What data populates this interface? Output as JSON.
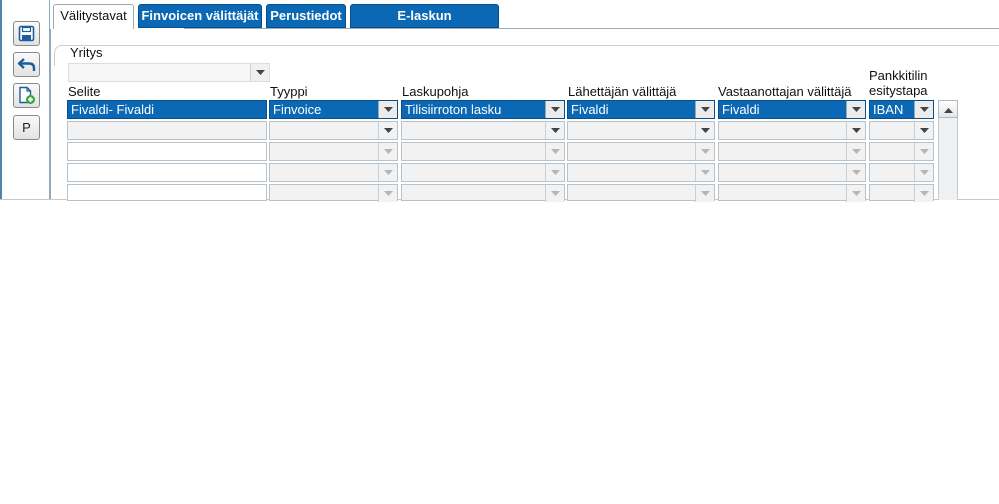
{
  "tabs": [
    {
      "label": "Välitystavat",
      "active": true
    },
    {
      "label": "Finvoicen välittäjät",
      "active": false
    },
    {
      "label": "Perustiedot",
      "active": false
    },
    {
      "label": "E-laskun laskutusaiheet",
      "active": false
    }
  ],
  "toolbar": {
    "print_label": "P"
  },
  "form": {
    "yritys_label": "Yritys",
    "yritys_value": "",
    "columns": {
      "selite": "Selite",
      "tyyppi": "Tyyppi",
      "laskupohja": "Laskupohja",
      "lahettaja": "Lähettäjän välittäjä",
      "vastaanottaja": "Vastaanottajan välittäjä",
      "pankkitili_1": "Pankkitilin",
      "pankkitili_2": "esitystapa"
    },
    "rows": [
      {
        "selite": "Fivaldi- Fivaldi",
        "tyyppi": "Finvoice",
        "laskupohja": "Tilisiirroton lasku",
        "lahettaja": "Fivaldi",
        "vastaanottaja": "Fivaldi",
        "pankkitili": "IBAN"
      },
      {
        "selite": "",
        "tyyppi": "",
        "laskupohja": "",
        "lahettaja": "",
        "vastaanottaja": "",
        "pankkitili": ""
      },
      {
        "selite": "",
        "tyyppi": "",
        "laskupohja": "",
        "lahettaja": "",
        "vastaanottaja": "",
        "pankkitili": ""
      },
      {
        "selite": "",
        "tyyppi": "",
        "laskupohja": "",
        "lahettaja": "",
        "vastaanottaja": "",
        "pankkitili": ""
      },
      {
        "selite": "",
        "tyyppi": "",
        "laskupohja": "",
        "lahettaja": "",
        "vastaanottaja": "",
        "pankkitili": ""
      }
    ]
  },
  "colors": {
    "selected": "#0b68b4",
    "tab_inactive": "#0b68b4"
  },
  "icons": [
    "save-icon",
    "undo-icon",
    "new-document-icon",
    "print-p-icon",
    "chevron-down-icon",
    "scroll-up-arrow-icon"
  ]
}
